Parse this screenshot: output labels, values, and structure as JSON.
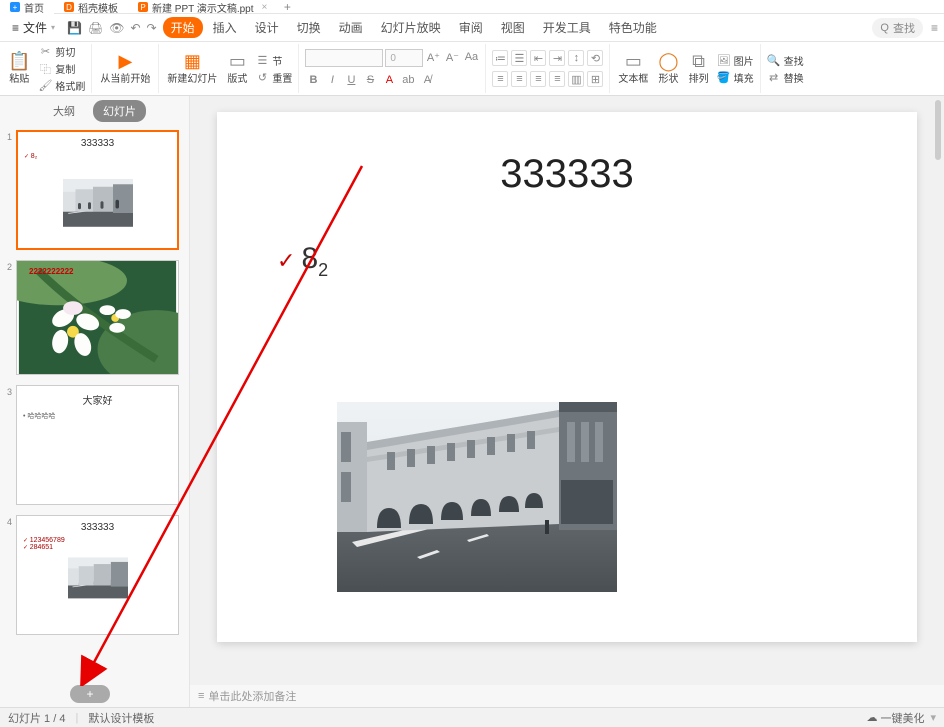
{
  "tabs": {
    "home": "首页",
    "template": "稻壳模板",
    "file": "新建 PPT 演示文稿.ppt",
    "file_close": "×",
    "add": "+"
  },
  "menu": {
    "file": "文件",
    "start": "开始",
    "insert": "插入",
    "design": "设计",
    "transition": "切换",
    "animation": "动画",
    "slideshow": "幻灯片放映",
    "review": "审阅",
    "view": "视图",
    "dev": "开发工具",
    "feature": "特色功能",
    "search_placeholder": "查找",
    "search_icon": "Q"
  },
  "ribbon": {
    "paste": "粘贴",
    "cut": "剪切",
    "copy": "复制",
    "format_painter": "格式刷",
    "from_current": "从当前开始",
    "new_slide": "新建幻灯片",
    "layout": "版式",
    "section": "节",
    "reset": "重置",
    "font_name": "",
    "font_size": "0",
    "bold": "B",
    "italic": "I",
    "underline": "U",
    "strike": "S",
    "text_box": "文本框",
    "shapes": "形状",
    "arrange": "排列",
    "picture": "图片",
    "fill": "填充",
    "find": "查找",
    "replace": "替换"
  },
  "left": {
    "outline": "大纲",
    "slides": "幻灯片"
  },
  "thumbs": [
    {
      "num": "1",
      "title": "333333",
      "bullet": "8₂"
    },
    {
      "num": "2",
      "overlay": "2222222222"
    },
    {
      "num": "3",
      "title": "大家好",
      "bullet_plain": "哈哈哈哈"
    },
    {
      "num": "4",
      "title": "333333",
      "line1": "123456789",
      "line2": "284651"
    }
  ],
  "slide": {
    "title": "333333",
    "bullet_main": "8",
    "bullet_sub": "2"
  },
  "notes": {
    "placeholder": "单击此处添加备注"
  },
  "status": {
    "page": "幻灯片 1 / 4",
    "template": "默认设计模板",
    "beautify": "一键美化"
  }
}
